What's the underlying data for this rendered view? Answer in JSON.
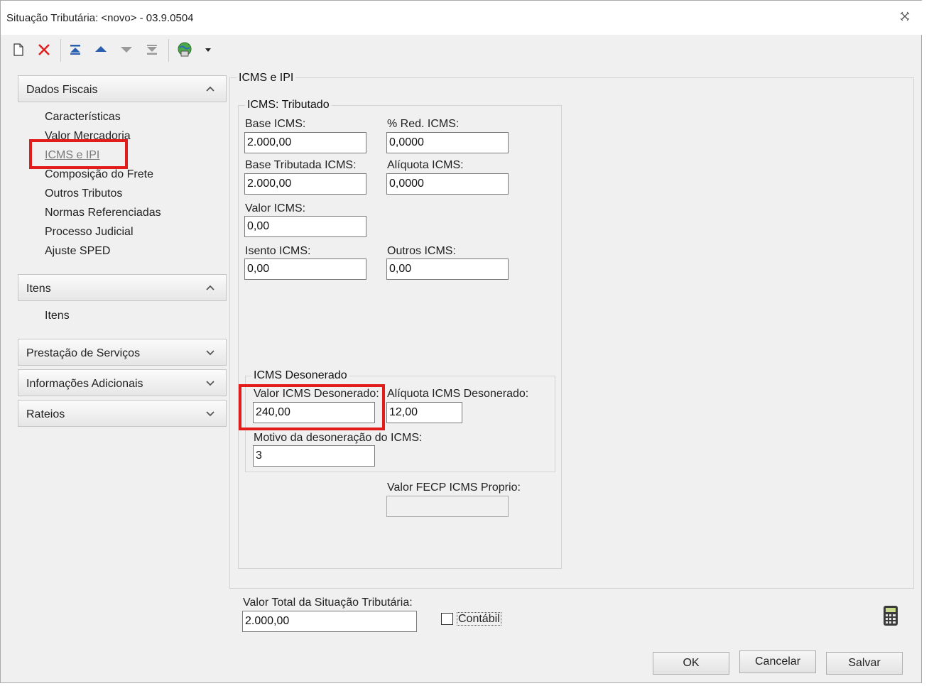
{
  "window": {
    "title": "Situação Tributária: <novo> - 03.9.0504",
    "close_icon": "close-icon"
  },
  "toolbar": {
    "icons": [
      "new-document-icon",
      "delete-icon",
      "first-record-icon",
      "previous-record-icon",
      "next-record-icon",
      "last-record-icon",
      "globe-print-icon",
      "dropdown-arrow-icon"
    ]
  },
  "sidebar": {
    "dados_fiscais": {
      "header": "Dados Fiscais",
      "items": [
        "Características",
        "Valor Mercadoria",
        "ICMS e IPI",
        "Composição do Frete",
        "Outros Tributos",
        "Normas Referenciadas",
        "Processo Judicial",
        "Ajuste SPED"
      ]
    },
    "itens": {
      "header": "Itens",
      "items": [
        "Itens"
      ]
    },
    "prestacao": {
      "header": "Prestação de Serviços"
    },
    "informacoes": {
      "header": "Informações Adicionais"
    },
    "rateios": {
      "header": "Rateios"
    }
  },
  "main": {
    "section_title": "ICMS e IPI",
    "tributado": {
      "legend": "ICMS: Tributado",
      "base_icms_label": "Base ICMS:",
      "base_icms_value": "2.000,00",
      "red_icms_label": "% Red. ICMS:",
      "red_icms_value": "0,0000",
      "base_tributada_label": "Base Tributada ICMS:",
      "base_tributada_value": "2.000,00",
      "aliquota_label": "Alíquota ICMS:",
      "aliquota_value": "0,0000",
      "valor_icms_label": "Valor ICMS:",
      "valor_icms_value": "0,00",
      "isento_label": "Isento ICMS:",
      "isento_value": "0,00",
      "outros_label": "Outros ICMS:",
      "outros_value": "0,00"
    },
    "desonerado": {
      "legend": "ICMS Desonerado",
      "valor_label": "Valor ICMS Desonerado:",
      "valor_value": "240,00",
      "aliquota_label": "Alíquota ICMS Desonerado:",
      "aliquota_value": "12,00",
      "motivo_label": "Motivo da desoneração do ICMS:",
      "motivo_value": "3"
    },
    "fecp_label": "Valor FECP ICMS Proprio:",
    "fecp_value": ""
  },
  "footer": {
    "total_label": "Valor Total da Situação Tributária:",
    "total_value": "2.000,00",
    "contabil_label": "Contábil",
    "contabil_checked": false,
    "calculator_icon": "calculator-icon",
    "ok_label": "OK",
    "cancel_label": "Cancelar",
    "save_label": "Salvar"
  },
  "colors": {
    "highlight": "#e21b1b",
    "window_bg": "#f0f0f0"
  }
}
